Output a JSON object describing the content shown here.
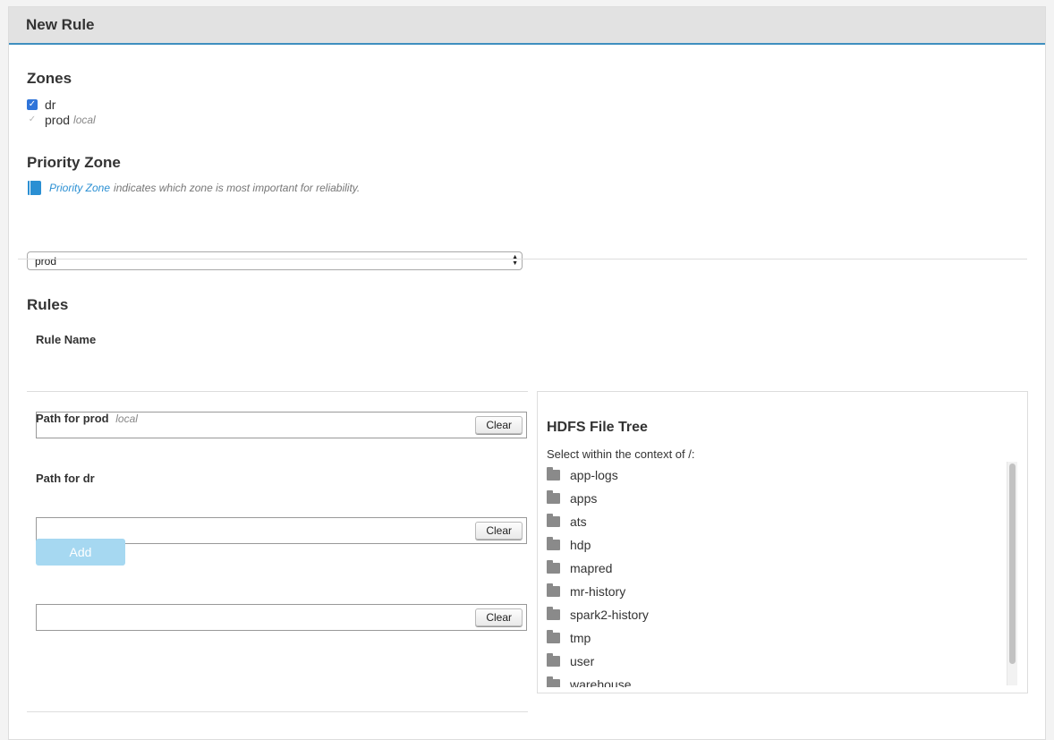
{
  "header": {
    "title": "New Rule"
  },
  "zones": {
    "heading": "Zones",
    "items": [
      {
        "name": "dr",
        "tag": "",
        "checked": true
      },
      {
        "name": "prod",
        "tag": "local",
        "checked": true,
        "disabled": true
      }
    ]
  },
  "priority": {
    "heading": "Priority Zone",
    "help_link": "Priority Zone",
    "help_text": "indicates which zone is most important for reliability.",
    "selected": "prod",
    "book_icon": "book-icon"
  },
  "rules": {
    "heading": "Rules",
    "rule_name_label": "Rule Name",
    "rule_name_value": "",
    "path_prod_label": "Path for prod",
    "path_prod_tag": "local",
    "path_prod_value": "",
    "path_dr_label": "Path for dr",
    "path_dr_value": "",
    "clear_label": "Clear",
    "add_label": "Add"
  },
  "tree": {
    "heading": "HDFS File Tree",
    "context": "Select within the context of /:",
    "items": [
      "app-logs",
      "apps",
      "ats",
      "hdp",
      "mapred",
      "mr-history",
      "spark2-history",
      "tmp",
      "user",
      "warehouse"
    ]
  }
}
